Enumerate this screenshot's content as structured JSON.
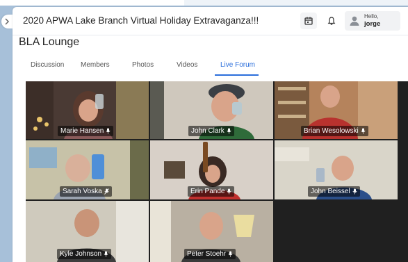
{
  "header": {
    "group_title": "2020 APWA Lake Branch Virtual Holiday Extravaganza!!!",
    "user": {
      "greeting": "Hello,",
      "name": "jorge"
    }
  },
  "page_title": "BLA Lounge",
  "tabs": [
    {
      "label": "Discussion"
    },
    {
      "label": "Members"
    },
    {
      "label": "Photos"
    },
    {
      "label": "Videos"
    },
    {
      "label": "Live Forum",
      "active": true
    }
  ],
  "participants": [
    {
      "name": "Marie Hansen"
    },
    {
      "name": "John Clark"
    },
    {
      "name": "Brian Wesolowski"
    },
    {
      "name": "Sarah Voska"
    },
    {
      "name": "Erin Pande"
    },
    {
      "name": "John Beissel"
    },
    {
      "name": "Kyle Johnson"
    },
    {
      "name": "Peter Stoehr"
    }
  ],
  "colors": {
    "accent": "#2a6edb",
    "active_speaker_border": "#4b7bdc"
  }
}
